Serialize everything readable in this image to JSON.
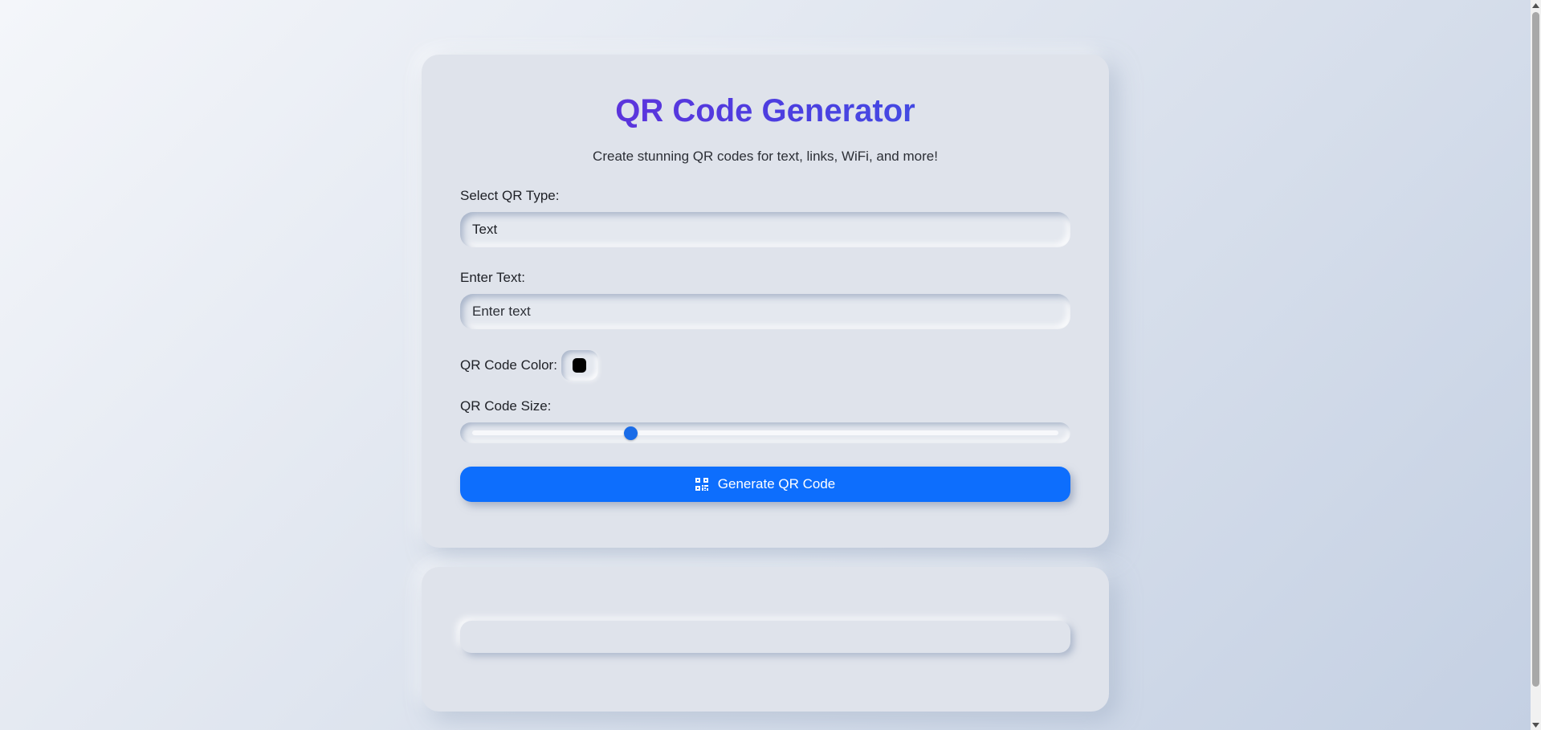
{
  "header": {
    "title": "QR Code Generator",
    "subtitle": "Create stunning QR codes for text, links, WiFi, and more!"
  },
  "form": {
    "type_label": "Select QR Type:",
    "type_value": "Text",
    "text_label": "Enter Text:",
    "text_placeholder": "Enter text",
    "text_value": "",
    "color_label": "QR Code Color:",
    "color_value": "#000000",
    "size_label": "QR Code Size:",
    "size_fraction": 0.27,
    "generate_label": "Generate QR Code",
    "generate_icon": "qrcode-icon"
  },
  "colors": {
    "accent": "#0d6efd",
    "title_gradient_start": "#6a2bd9",
    "title_gradient_end": "#3b57e6",
    "card_bg": "#dfe3eb"
  }
}
